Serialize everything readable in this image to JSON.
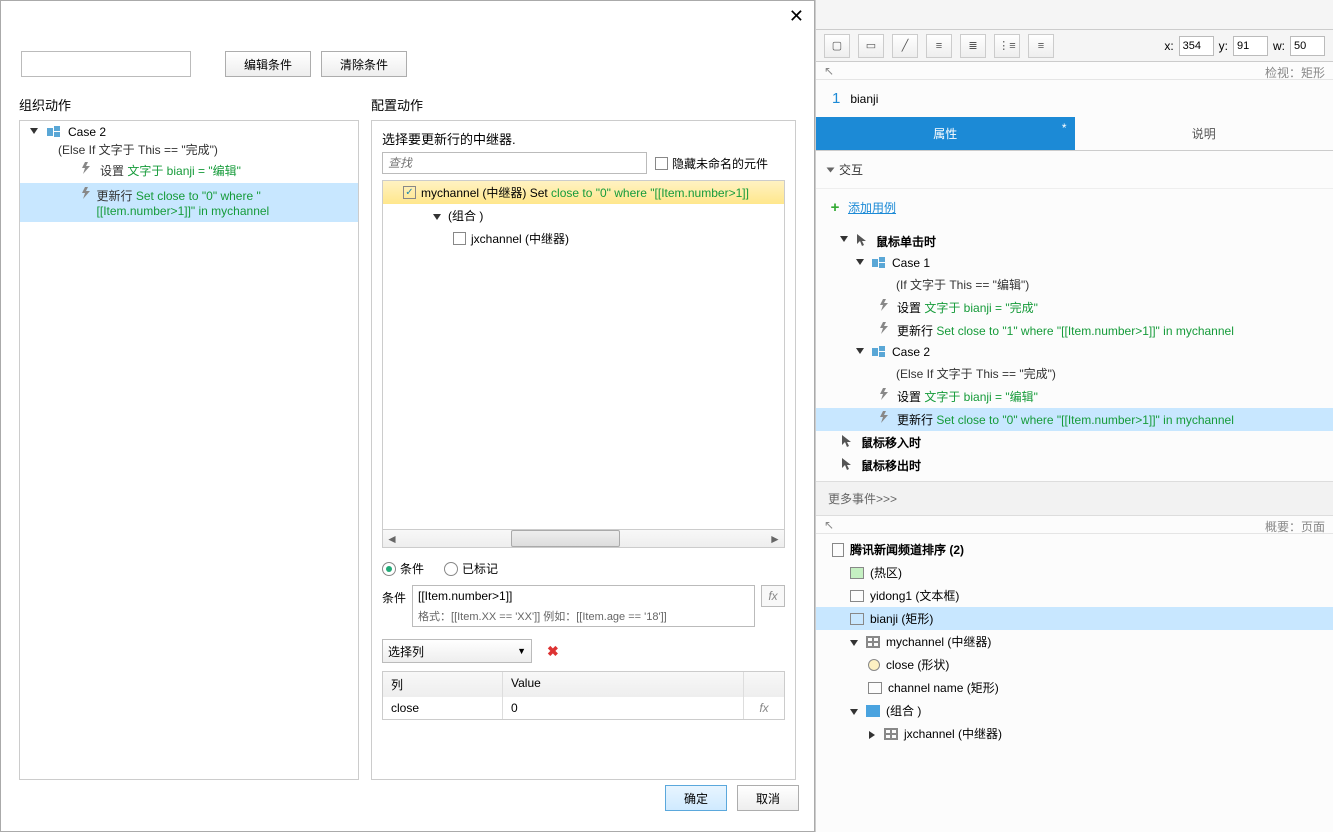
{
  "dialog": {
    "edit_btn": "编辑条件",
    "clear_btn": "清除条件",
    "left_header": "组织动作",
    "right_header": "配置动作",
    "case_name": "Case 2",
    "case_cond": "(Else If 文字于 This == \"完成\")",
    "action1_pre": "设置 ",
    "action1_green": "文字于 bianji = \"编辑\"",
    "action2_pre": "更新行 ",
    "action2_green": "Set close to \"0\" where \"[[Item.number>1]]\" in mychannel",
    "prompt": "选择要更新行的中继器.",
    "search_ph": "查找",
    "hide_unnamed": "隐藏未命名的元件",
    "tree_item1_pre": "mychannel (中继器) Set ",
    "tree_item1_green": "close to \"0\" where \"[[Item.number>1]]",
    "tree_group": "(组合 )",
    "tree_item2": "jxchannel (中继器)",
    "radio_cond": "条件",
    "radio_marked": "已标记",
    "cond_label": "条件",
    "cond_value": "[[Item.number>1]]",
    "cond_hint": "格式：[[Item.XX == 'XX']] 例如：[[Item.age == '18']]",
    "select_col": "选择列",
    "th_col": "列",
    "th_val": "Value",
    "row_col": "close",
    "row_val": "0",
    "fx": "fx",
    "ok": "确定",
    "cancel": "取消"
  },
  "right": {
    "coord_x_lbl": "x:",
    "coord_x": "354",
    "coord_y_lbl": "y:",
    "coord_y": "91",
    "coord_w_lbl": "w:",
    "coord_w": "50",
    "inspect_label": "检视：矩形",
    "num": "1",
    "widget_name": "bianji",
    "tab_props": "属性",
    "tab_notes": "说明",
    "sec_inter": "交互",
    "add_case": "添加用例",
    "ev_click": "鼠标单击时",
    "c1": "Case 1",
    "c1_cond": "(If 文字于 This == \"编辑\")",
    "c1_a1_pre": "设置 ",
    "c1_a1_g": "文字于 bianji = \"完成\"",
    "c1_a2_pre": "更新行 ",
    "c1_a2_g": "Set close to \"1\" where \"[[Item.number>1]]\" in mychannel",
    "c2": "Case 2",
    "c2_cond": "(Else If 文字于 This == \"完成\")",
    "c2_a1_pre": "设置 ",
    "c2_a1_g": "文字于 bianji = \"编辑\"",
    "c2_a2_pre": "更新行 ",
    "c2_a2_g": "Set close to \"0\" where \"[[Item.number>1]]\" in mychannel",
    "ev_over": "鼠标移入时",
    "ev_out": "鼠标移出时",
    "more": "更多事件>>>",
    "ol_header": "概要：页面",
    "ol_root": "腾讯新闻频道排序 (2)",
    "ol_hot": "(热区)",
    "ol_yd": "yidong1 (文本框)",
    "ol_bj": "bianji (矩形)",
    "ol_my": "mychannel (中继器)",
    "ol_close": "close (形状)",
    "ol_cn": "channel name (矩形)",
    "ol_grp": "(组合 )",
    "ol_jx": "jxchannel (中继器)"
  }
}
